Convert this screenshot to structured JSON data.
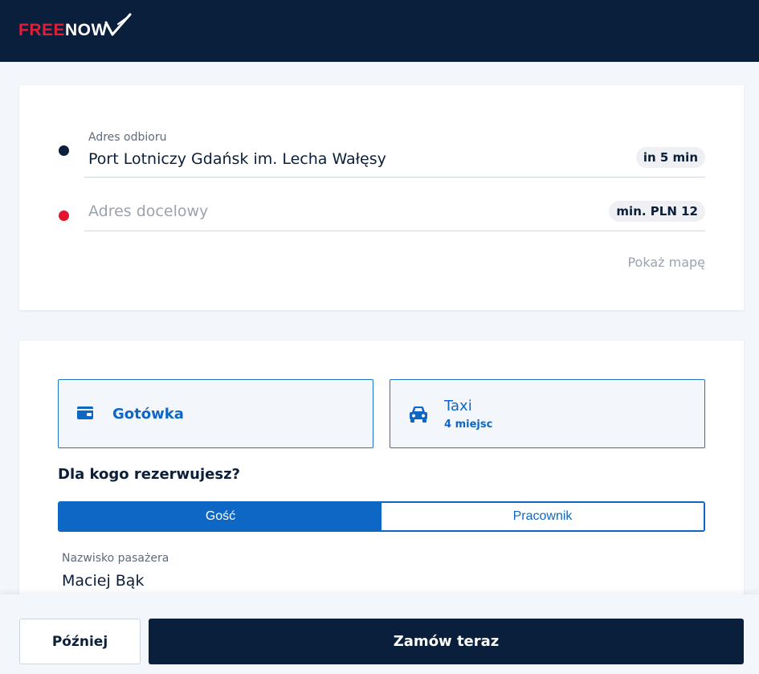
{
  "brand": {
    "free": "FREE",
    "now": "NOW",
    "accent": "#e01e37",
    "navy": "#0a1f3c"
  },
  "route": {
    "pickup": {
      "label": "Adres odbioru",
      "value": "Port Lotniczy Gdańsk im. Lecha Wałęsy",
      "eta": "in 5 min",
      "icon": "pickup-dot-icon"
    },
    "destination": {
      "placeholder": "Adres docelowy",
      "price": "min. PLN 12",
      "icon": "destination-dot-icon"
    },
    "show_map": "Pokaż mapę"
  },
  "options": {
    "payment": {
      "label": "Gotówka",
      "icon": "wallet-icon"
    },
    "vehicle": {
      "title": "Taxi",
      "subtitle": "4 miejsc",
      "icon": "car-icon"
    }
  },
  "booking": {
    "question": "Dla kogo rezerwujesz?",
    "segments": [
      "Gość",
      "Pracownik"
    ],
    "active_segment": "Gość"
  },
  "passenger": {
    "label": "Nazwisko pasażera",
    "value": "Maciej Bąk"
  },
  "footer": {
    "later_label": "Później",
    "order_label": "Zamów teraz"
  },
  "colors": {
    "primary_blue": "#0e67c4",
    "navy": "#0a1f3c",
    "red": "#e4132e"
  }
}
